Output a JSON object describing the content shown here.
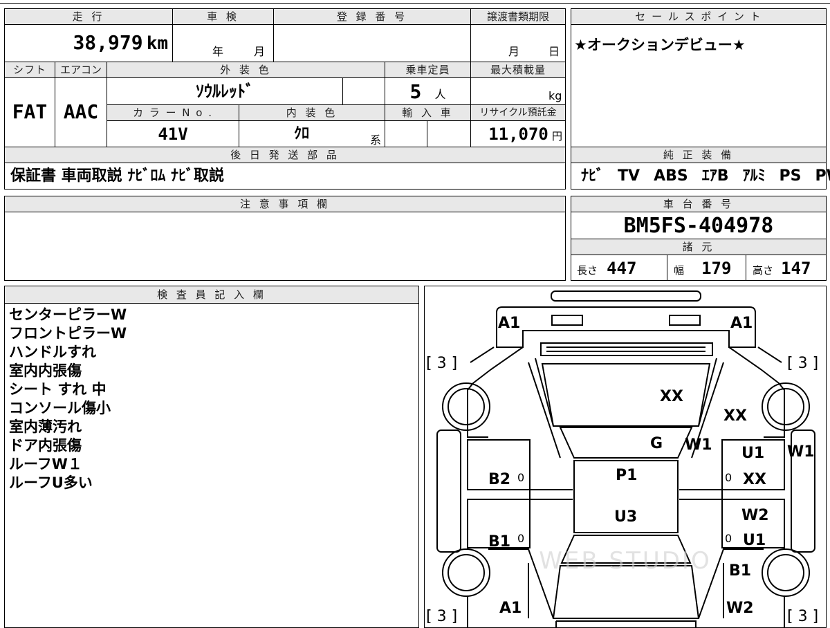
{
  "form": {
    "mileage": {
      "label": "走 行",
      "value": "38,979",
      "unit": "km"
    },
    "inspection": {
      "label": "車 検",
      "year": "年",
      "month": "月"
    },
    "registration": {
      "label": "登 録 番 号",
      "value": ""
    },
    "transfer_deadline": {
      "label": "譲渡書類期限",
      "month": "月",
      "day": "日"
    },
    "shift": {
      "label": "シフト",
      "value": "FAT"
    },
    "aircon": {
      "label": "エアコン",
      "value": "AAC"
    },
    "exterior_color": {
      "label": "外 装 色",
      "value": "ｿｳﾙﾚｯﾄﾞ"
    },
    "capacity": {
      "label": "乗車定員",
      "value": "5",
      "unit": "人"
    },
    "max_load": {
      "label": "最大積載量",
      "unit": "kg"
    },
    "color_no": {
      "label": "カ ラ ー N o .",
      "value": "41V"
    },
    "interior_color": {
      "label": "内 装 色",
      "value": "ｸﾛ",
      "suffix": "系"
    },
    "import": {
      "label": "輸 入 車"
    },
    "recycle": {
      "label": "リサイクル預託金",
      "value": "11,070",
      "unit": "円"
    },
    "later_parts": {
      "label": "後 日 発 送 部 品",
      "value": "保証書 車両取説 ﾅﾋﾞﾛﾑ ﾅﾋﾞ取説"
    },
    "sales_point": {
      "label": "セ ー ル ス ポ イ ン ト",
      "value": "★オークションデビュー★"
    },
    "genuine_equipment": {
      "label": "純 正 装 備",
      "items": [
        "ﾅﾋﾞ",
        "TV",
        "ABS",
        "ｴｱB",
        "ｱﾙﾐ",
        "PS",
        "PW"
      ]
    },
    "caution": {
      "label": "注 意 事 項 欄",
      "value": ""
    },
    "chassis": {
      "label": "車 台 番 号",
      "value": "BM5FS-404978"
    },
    "specs": {
      "label": "諸 元",
      "length_label": "長さ",
      "length": "447",
      "width_label": "幅",
      "width": "179",
      "height_label": "高さ",
      "height": "147"
    },
    "inspector": {
      "label": "検 査 員 記 入 欄",
      "notes": [
        "センターピラーW",
        "フロントピラーW",
        "ハンドルすれ",
        "室内内張傷",
        "シート すれ 中",
        "コンソール傷小",
        "室内薄汚れ",
        "ドア内張傷",
        "ルーフW１",
        "ルーフU多い"
      ]
    }
  },
  "diagram": {
    "marks": {
      "front_left": "A1",
      "front_right": "A1",
      "tire_fl": "[ 3 ]",
      "tire_fr": "[ 3 ]",
      "tire_rl": "[ 3 ]",
      "tire_rr": "[ 3 ]",
      "hood": "XX",
      "fender_right": "XX",
      "windshield": "G",
      "pillar_right": "W1",
      "roof": "P1",
      "roof_rear": "U3",
      "door_rl_front": "B2",
      "door_rl_front_zero": "0",
      "door_rl_rear": "B1",
      "door_rl_rear_zero": "0",
      "door_fr_top": "U1",
      "door_fr_zero": "0",
      "door_fr_xx": "XX",
      "sill_right": "W1",
      "door_rr_top": "W2",
      "door_rr_zero": "0",
      "door_rr_u1": "U1",
      "quarter_right": "B1",
      "rear_left": "A1",
      "rear_right": "W2"
    },
    "watermark": "WEB STUDIO"
  }
}
